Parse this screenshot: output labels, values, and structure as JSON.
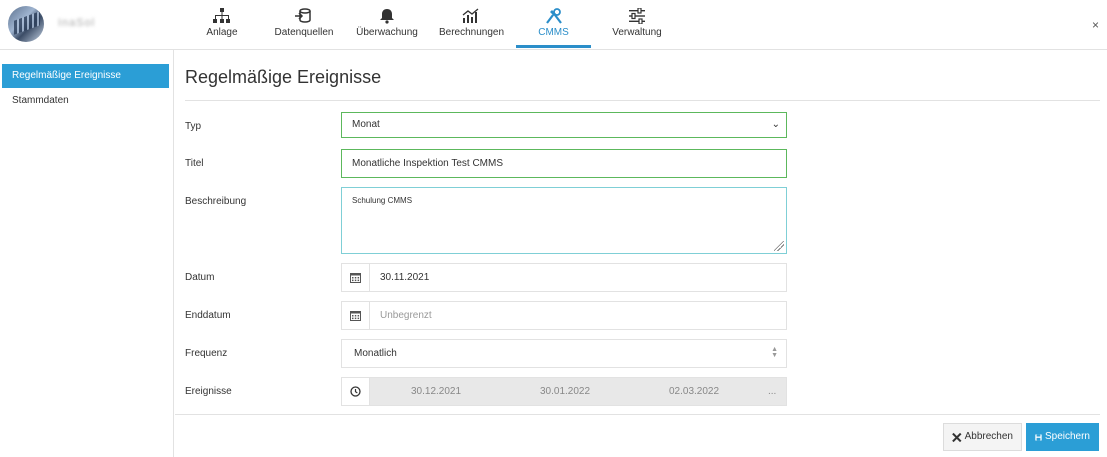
{
  "brand": {
    "name": "InaSol"
  },
  "nav": {
    "tabs": [
      {
        "label": "Anlage",
        "icon": "sitemap-icon"
      },
      {
        "label": "Datenquellen",
        "icon": "database-icon"
      },
      {
        "label": "Überwachung",
        "icon": "bell-icon"
      },
      {
        "label": "Berechnungen",
        "icon": "chart-icon"
      },
      {
        "label": "CMMS",
        "icon": "tools-icon",
        "active": true
      },
      {
        "label": "Verwaltung",
        "icon": "sliders-icon"
      }
    ],
    "close_label": "×"
  },
  "sidebar": {
    "items": [
      {
        "label": "Regelmäßige Ereignisse",
        "active": true
      },
      {
        "label": "Stammdaten"
      }
    ]
  },
  "page": {
    "title": "Regelmäßige Ereignisse"
  },
  "form": {
    "typ": {
      "label": "Typ",
      "value": "Monat"
    },
    "titel": {
      "label": "Titel",
      "value": "Monatliche Inspektion Test CMMS"
    },
    "beschreibung": {
      "label": "Beschreibung",
      "value": "Schulung CMMS"
    },
    "datum": {
      "label": "Datum",
      "value": "30.11.2021"
    },
    "enddatum": {
      "label": "Enddatum",
      "placeholder": "Unbegrenzt"
    },
    "frequenz": {
      "label": "Frequenz",
      "value": "Monatlich"
    },
    "ereignisse": {
      "label": "Ereignisse",
      "dates": [
        "30.12.2021",
        "30.01.2022",
        "02.03.2022"
      ],
      "more": "..."
    }
  },
  "buttons": {
    "cancel": "Abbrechen",
    "save": "Speichern"
  },
  "colors": {
    "accent": "#2b9ed6",
    "valid": "#5cb85c"
  }
}
